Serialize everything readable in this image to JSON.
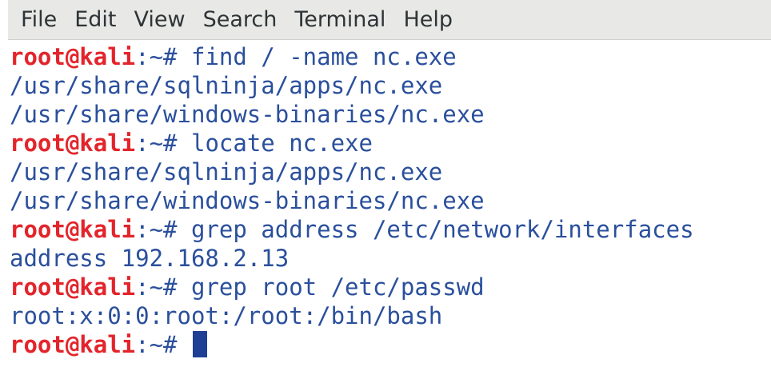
{
  "menu": {
    "items": [
      "File",
      "Edit",
      "View",
      "Search",
      "Terminal",
      "Help"
    ]
  },
  "colors": {
    "prompt_user": "#e3242b",
    "text": "#2a4f9c",
    "cursor": "#1e3f94",
    "menubar_bg": "#e8e8e7"
  },
  "terminal": {
    "prompt_user": "root@kali",
    "prompt_path": ":~# ",
    "lines": [
      {
        "kind": "cmd",
        "text": "find / -name nc.exe"
      },
      {
        "kind": "out",
        "text": "/usr/share/sqlninja/apps/nc.exe"
      },
      {
        "kind": "out",
        "text": "/usr/share/windows-binaries/nc.exe"
      },
      {
        "kind": "cmd",
        "text": "locate nc.exe"
      },
      {
        "kind": "out",
        "text": "/usr/share/sqlninja/apps/nc.exe"
      },
      {
        "kind": "out",
        "text": "/usr/share/windows-binaries/nc.exe"
      },
      {
        "kind": "cmd",
        "text": "grep address /etc/network/interfaces"
      },
      {
        "kind": "out",
        "text": "address 192.168.2.13"
      },
      {
        "kind": "cmd",
        "text": "grep root /etc/passwd"
      },
      {
        "kind": "out",
        "text": "root:x:0:0:root:/root:/bin/bash"
      },
      {
        "kind": "cmd",
        "text": ""
      }
    ]
  }
}
